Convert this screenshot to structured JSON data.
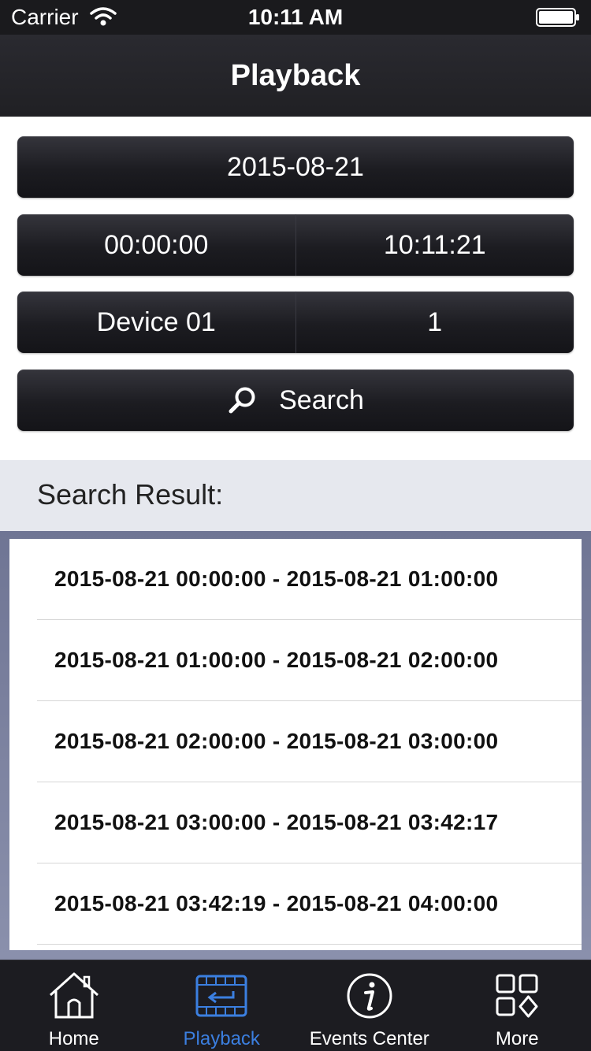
{
  "status_bar": {
    "carrier": "Carrier",
    "time": "10:11 AM"
  },
  "nav": {
    "title": "Playback"
  },
  "controls": {
    "date": "2015-08-21",
    "start_time": "00:00:00",
    "end_time": "10:11:21",
    "device": "Device 01",
    "channel": "1",
    "search_label": "Search"
  },
  "results": {
    "header": "Search Result:",
    "rows": [
      "2015-08-21 00:00:00 - 2015-08-21 01:00:00",
      "2015-08-21 01:00:00 - 2015-08-21 02:00:00",
      "2015-08-21 02:00:00 - 2015-08-21 03:00:00",
      "2015-08-21 03:00:00 - 2015-08-21 03:42:17",
      "2015-08-21 03:42:19 - 2015-08-21 04:00:00"
    ]
  },
  "tabs": [
    {
      "label": "Home",
      "icon": "home-icon"
    },
    {
      "label": "Playback",
      "icon": "playback-icon",
      "active": true
    },
    {
      "label": "Events Center",
      "icon": "info-icon"
    },
    {
      "label": "More",
      "icon": "more-grid-icon"
    }
  ],
  "colors": {
    "accent": "#3b7fe0",
    "bar_dark": "#1c1c21",
    "results_frame": "#7a809e"
  }
}
